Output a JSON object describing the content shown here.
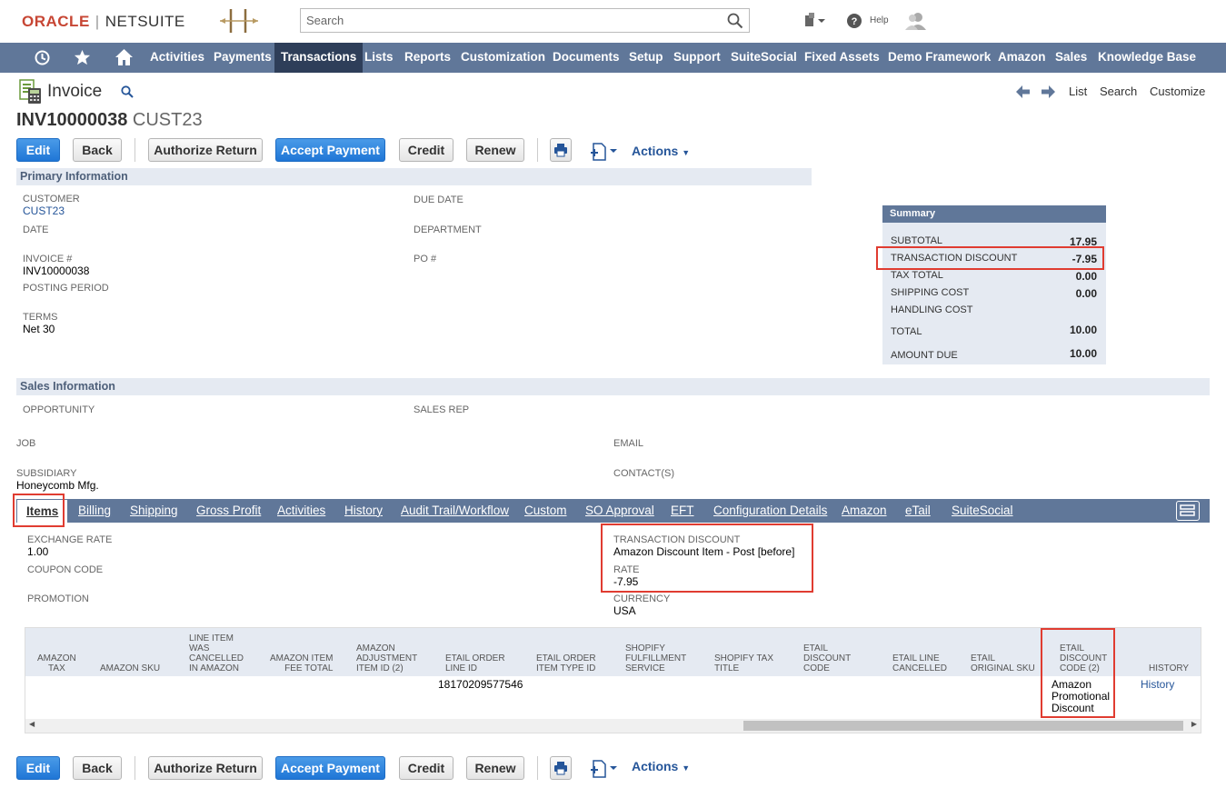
{
  "header": {
    "logo_oracle": "ORACLE",
    "logo_sep": "|",
    "logo_netsuite": "NETSUITE",
    "search_placeholder": "Search",
    "help_label": "Help"
  },
  "nav": {
    "items": [
      "Activities",
      "Payments",
      "Transactions",
      "Lists",
      "Reports",
      "Customization",
      "Documents",
      "Setup",
      "Support",
      "SuiteSocial",
      "Fixed Assets",
      "Demo Framework",
      "Amazon",
      "Sales",
      "Knowledge Base"
    ],
    "active": "Transactions"
  },
  "page": {
    "title": "Invoice",
    "record_number": "INV10000038",
    "customer_ref": "CUST23",
    "top_links": {
      "list": "List",
      "search": "Search",
      "customize": "Customize"
    }
  },
  "toolbar": {
    "edit": "Edit",
    "back": "Back",
    "authorize_return": "Authorize Return",
    "accept_payment": "Accept Payment",
    "credit": "Credit",
    "renew": "Renew",
    "actions": "Actions"
  },
  "primary": {
    "section_title": "Primary Information",
    "customer_label": "CUSTOMER",
    "customer_value": "CUST23",
    "date_label": "DATE",
    "invoice_label": "INVOICE #",
    "invoice_value": "INV10000038",
    "posting_period_label": "POSTING PERIOD",
    "terms_label": "TERMS",
    "terms_value": "Net 30",
    "due_date_label": "DUE DATE",
    "department_label": "DEPARTMENT",
    "po_label": "PO #"
  },
  "summary": {
    "title": "Summary",
    "rows": [
      {
        "label": "SUBTOTAL",
        "value": "17.95"
      },
      {
        "label": "TRANSACTION DISCOUNT",
        "value": "-7.95"
      },
      {
        "label": "TAX TOTAL",
        "value": "0.00"
      },
      {
        "label": "SHIPPING COST",
        "value": "0.00"
      },
      {
        "label": "HANDLING COST",
        "value": ""
      },
      {
        "label": "TOTAL",
        "value": "10.00"
      },
      {
        "label": "AMOUNT DUE",
        "value": "10.00"
      }
    ]
  },
  "sales": {
    "section_title": "Sales Information",
    "opportunity_label": "OPPORTUNITY",
    "sales_rep_label": "SALES REP",
    "job_label": "JOB",
    "email_label": "EMAIL",
    "subsidiary_label": "SUBSIDIARY",
    "subsidiary_value": "Honeycomb Mfg.",
    "contacts_label": "CONTACT(S)"
  },
  "tabs": [
    "Items",
    "Billing",
    "Shipping",
    "Gross Profit",
    "Activities",
    "History",
    "Audit Trail/Workflow",
    "Custom",
    "SO Approval",
    "EFT",
    "Configuration Details",
    "Amazon",
    "eTail",
    "SuiteSocial"
  ],
  "items": {
    "exchange_rate_label": "EXCHANGE RATE",
    "exchange_rate_value": "1.00",
    "coupon_code_label": "COUPON CODE",
    "promotion_label": "PROMOTION",
    "transaction_discount_label": "TRANSACTION DISCOUNT",
    "transaction_discount_value": "Amazon Discount Item - Post [before]",
    "rate_label": "RATE",
    "rate_value": "-7.95",
    "currency_label": "CURRENCY",
    "currency_value": "USA"
  },
  "grid": {
    "columns": [
      "AMAZON\nTAX",
      "AMAZON SKU",
      "LINE ITEM\nWAS\nCANCELLED\nIN AMAZON",
      "AMAZON ITEM\nFEE TOTAL",
      "AMAZON\nADJUSTMENT\nITEM ID (2)",
      "ETAIL ORDER\nLINE ID",
      "ETAIL ORDER\nITEM TYPE ID",
      "SHOPIFY\nFULFILLMENT\nSERVICE",
      "SHOPIFY TAX\nTITLE",
      "ETAIL\nDISCOUNT\nCODE",
      "ETAIL LINE\nCANCELLED",
      "ETAIL\nORIGINAL SKU",
      "ETAIL\nDISCOUNT\nCODE (2)",
      "HISTORY"
    ],
    "row": {
      "etail_order_line_id": "18170209577546",
      "etail_discount_code_2": "Amazon\nPromotional\nDiscount",
      "history": "History"
    }
  }
}
